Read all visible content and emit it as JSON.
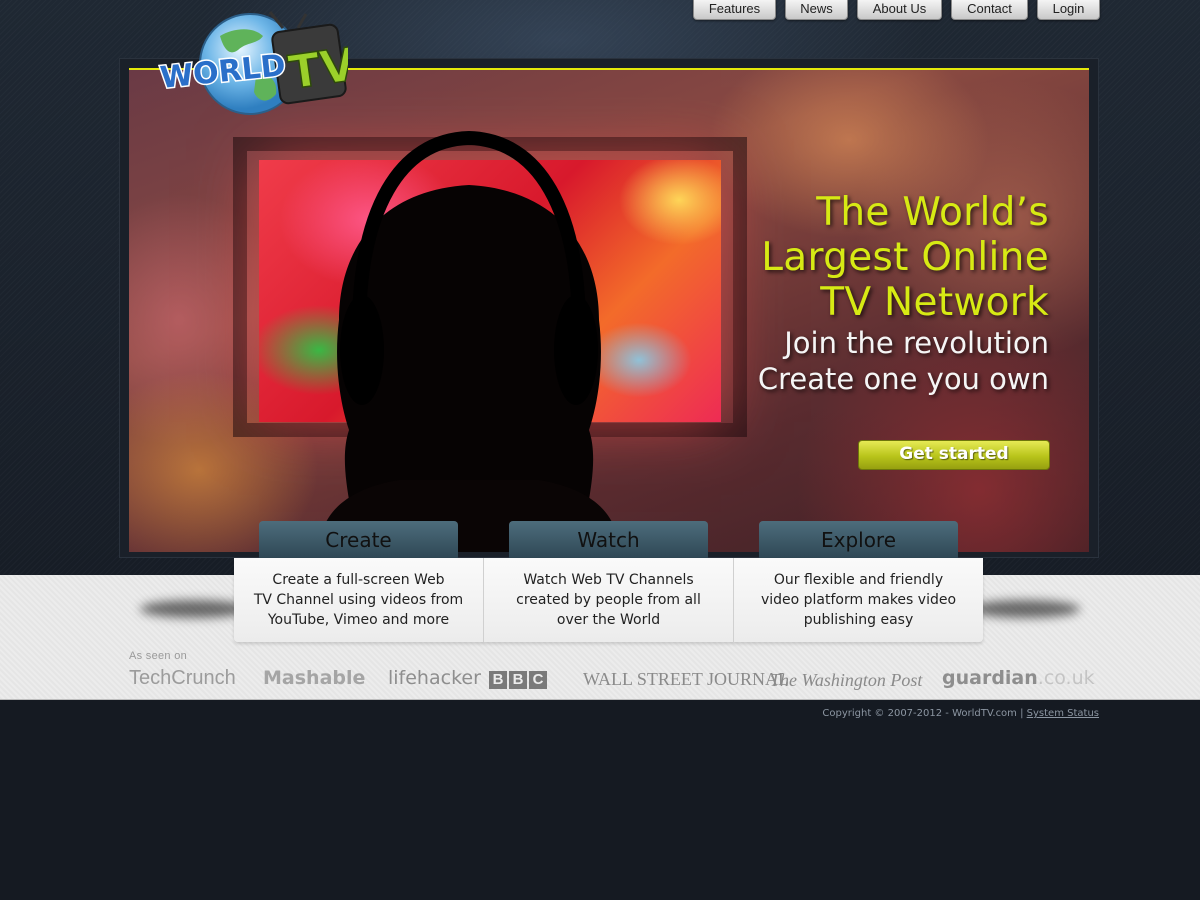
{
  "nav": {
    "features": "Features",
    "news": "News",
    "about": "About Us",
    "contact": "Contact",
    "login": "Login"
  },
  "logo": {
    "world": "WORLD",
    "tv": "TV"
  },
  "hero": {
    "headline_line1": "The World’s",
    "headline_line2": "Largest Online",
    "headline_line3": "TV Network",
    "sub_line1": "Join the revolution",
    "sub_line2": "Create one you own",
    "cta": "Get started"
  },
  "features": [
    {
      "tab": "Create",
      "line1": "Create a full-screen Web",
      "line2": "TV Channel using videos from",
      "line3": "YouTube, Vimeo and more"
    },
    {
      "tab": "Watch",
      "line1": "Watch Web TV Channels",
      "line2": "created by people from all",
      "line3": "over the World"
    },
    {
      "tab": "Explore",
      "line1": "Our flexible and friendly",
      "line2": "video platform makes video",
      "line3": "publishing easy"
    }
  ],
  "press": {
    "label": "As seen on",
    "techcrunch": "TechCrunch",
    "mashable": "Mashable",
    "lifehacker": "lifehacker",
    "bbc": [
      "B",
      "B",
      "C"
    ],
    "wsj": "WALL STREET JOURNAL",
    "wapo": "The Washington Post",
    "guardian": "guardian",
    "guardian_domain": ".co.uk"
  },
  "footer": {
    "copyright": "Copyright © 2007-2012 - WorldTV.com | ",
    "status_link": "System Status"
  },
  "colors": {
    "accent_yellow": "#d7ea14",
    "page_bg": "#151a22",
    "tab_teal": "#3d5a68"
  }
}
